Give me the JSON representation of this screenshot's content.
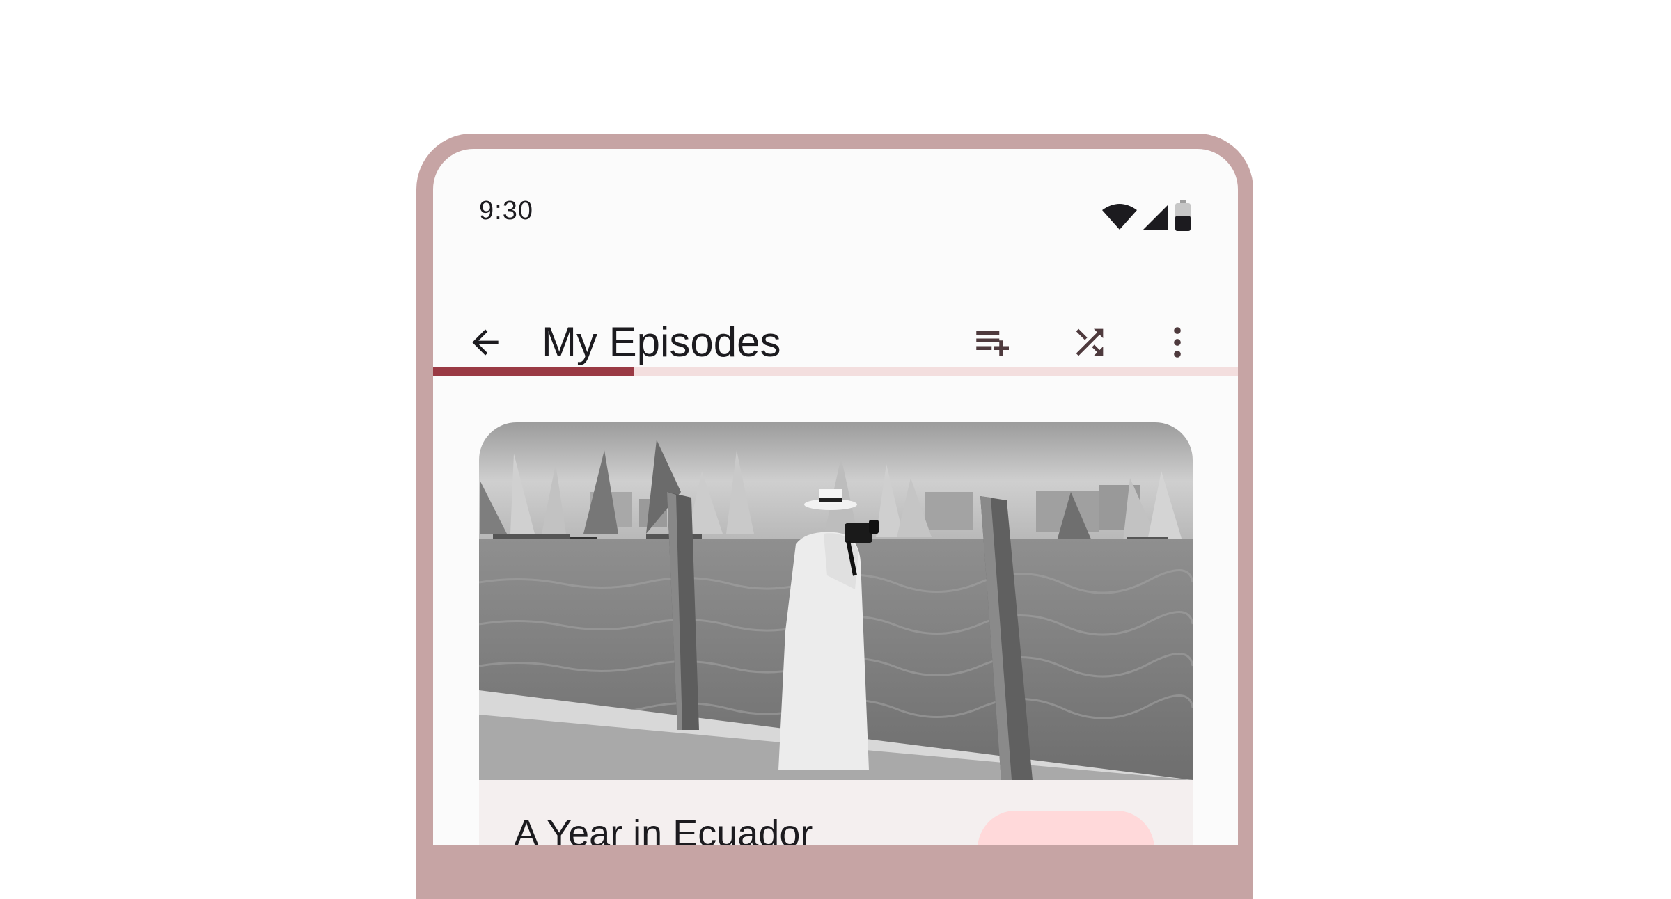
{
  "status_bar": {
    "time": "9:30",
    "icons": [
      "wifi-icon",
      "cellular-signal-icon",
      "battery-icon"
    ]
  },
  "top_app_bar": {
    "title": "My Episodes",
    "navigation_icon": "arrow-back-icon",
    "actions": [
      "playlist-add-icon",
      "shuffle-icon",
      "more-vert-icon"
    ]
  },
  "playback_progress": {
    "fraction": 0.25
  },
  "episode_card": {
    "title": "A Year in Ecuador",
    "image_alt": "Black-and-white photo of a photographer on a pier with sailboats on the water"
  },
  "colors": {
    "frame": "#c6a4a4",
    "accent": "#9a3a44",
    "progress_track": "#f3dede",
    "chip": "#ffd9da",
    "on_surface": "#1c1b1f",
    "icon": "#4e3a3d"
  }
}
